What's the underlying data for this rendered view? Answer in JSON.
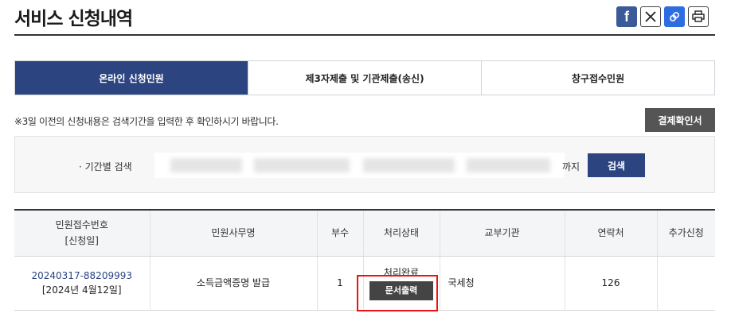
{
  "page": {
    "title": "서비스 신청내역"
  },
  "share": {
    "facebook": "f"
  },
  "tabs": [
    {
      "label": "온라인 신청민원",
      "active": true
    },
    {
      "label": "제3자제출 및 기관제출(송신)",
      "active": false
    },
    {
      "label": "창구접수민원",
      "active": false
    }
  ],
  "notice": "※3일 이전의 신청내용은 검색기간을 입력한 후 확인하시기 바랍니다.",
  "confirm_button": "결제확인서",
  "search": {
    "label": "· 기간별 검색",
    "until": "까지",
    "button": "검색"
  },
  "table": {
    "headers": {
      "receipt_no": "민원접수번호",
      "receipt_date": "[신청일]",
      "name": "민원사무명",
      "copies": "부수",
      "status": "처리상태",
      "org": "교부기관",
      "contact": "연락처",
      "extra": "추가신청"
    },
    "rows": [
      {
        "receipt_no": "20240317-88209993",
        "date": "[2024년 4월12일]",
        "name": "소득금액증명 발급",
        "copies": "1",
        "status": "처리완료",
        "action": "문서출력",
        "org": "국세청",
        "contact": "126",
        "extra": ""
      }
    ]
  },
  "colors": {
    "primary": "#2c4580",
    "highlight": "#e11111",
    "dark_button": "#444444"
  }
}
